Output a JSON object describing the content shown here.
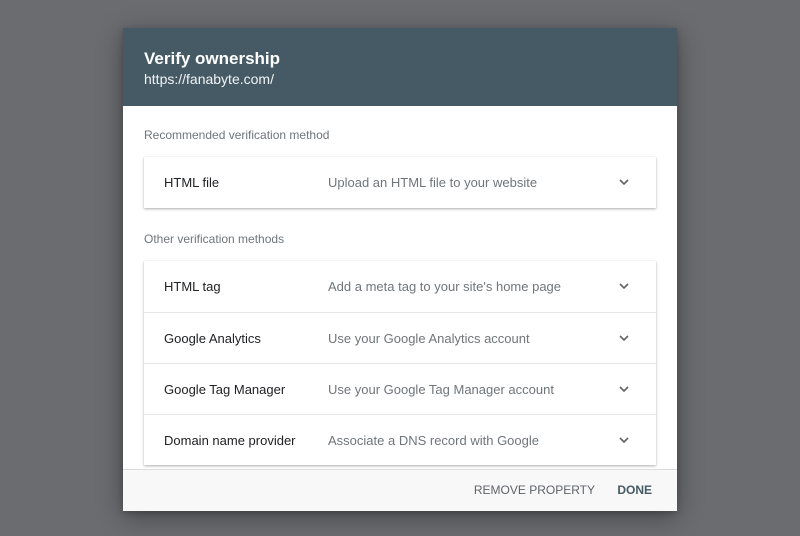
{
  "dialog": {
    "title": "Verify ownership",
    "url": "https://fanabyte.com/"
  },
  "recommended": {
    "label": "Recommended verification method",
    "methods": [
      {
        "name": "HTML file",
        "description": "Upload an HTML file to your website"
      }
    ]
  },
  "other": {
    "label": "Other verification methods",
    "methods": [
      {
        "name": "HTML tag",
        "description": "Add a meta tag to your site's home page"
      },
      {
        "name": "Google Analytics",
        "description": "Use your Google Analytics account"
      },
      {
        "name": "Google Tag Manager",
        "description": "Use your Google Tag Manager account"
      },
      {
        "name": "Domain name provider",
        "description": "Associate a DNS record with Google"
      }
    ]
  },
  "footer": {
    "remove_label": "REMOVE PROPERTY",
    "done_label": "DONE"
  },
  "colors": {
    "header_bg": "#465a65",
    "overlay_bg": "#6b6c70"
  },
  "icons": {
    "expand": "chevron-down-icon"
  }
}
